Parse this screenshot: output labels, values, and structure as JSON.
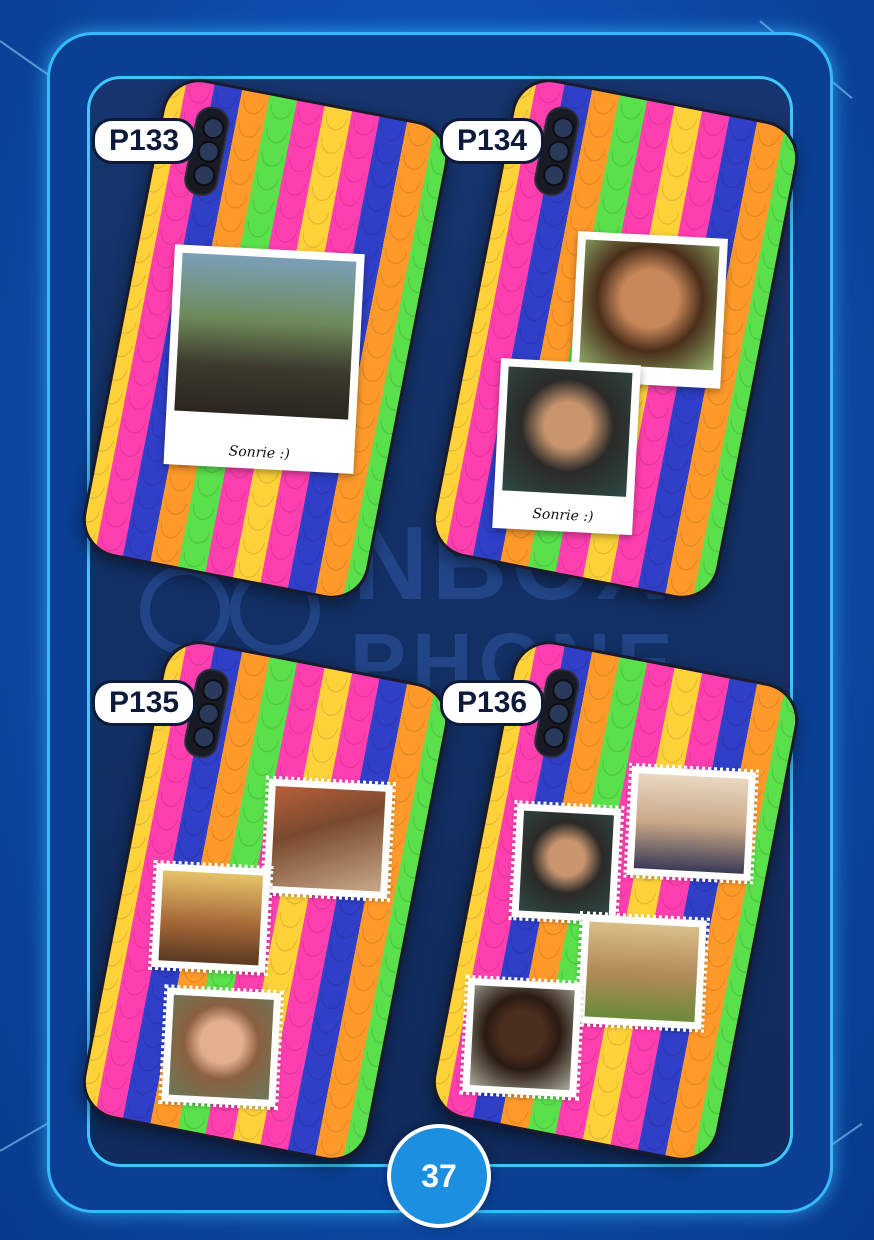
{
  "products": [
    {
      "code": "P133",
      "caption": "Sonrie :)"
    },
    {
      "code": "P134",
      "caption": "Sonrie :)"
    },
    {
      "code": "P135"
    },
    {
      "code": "P136"
    }
  ],
  "watermark": {
    "line1": "INBOX",
    "line2": "PHONE"
  },
  "page_number": "37",
  "colors": {
    "background": "#0e4fb0",
    "frame_border": "#35b9ff",
    "pattern_pink": "#ff3fb0",
    "pattern_yellow": "#ffd23a",
    "pattern_blue": "#2f3fc8",
    "pattern_orange": "#ff9a2a",
    "pattern_green": "#5ae04a",
    "badge": "#1d8fe0"
  }
}
